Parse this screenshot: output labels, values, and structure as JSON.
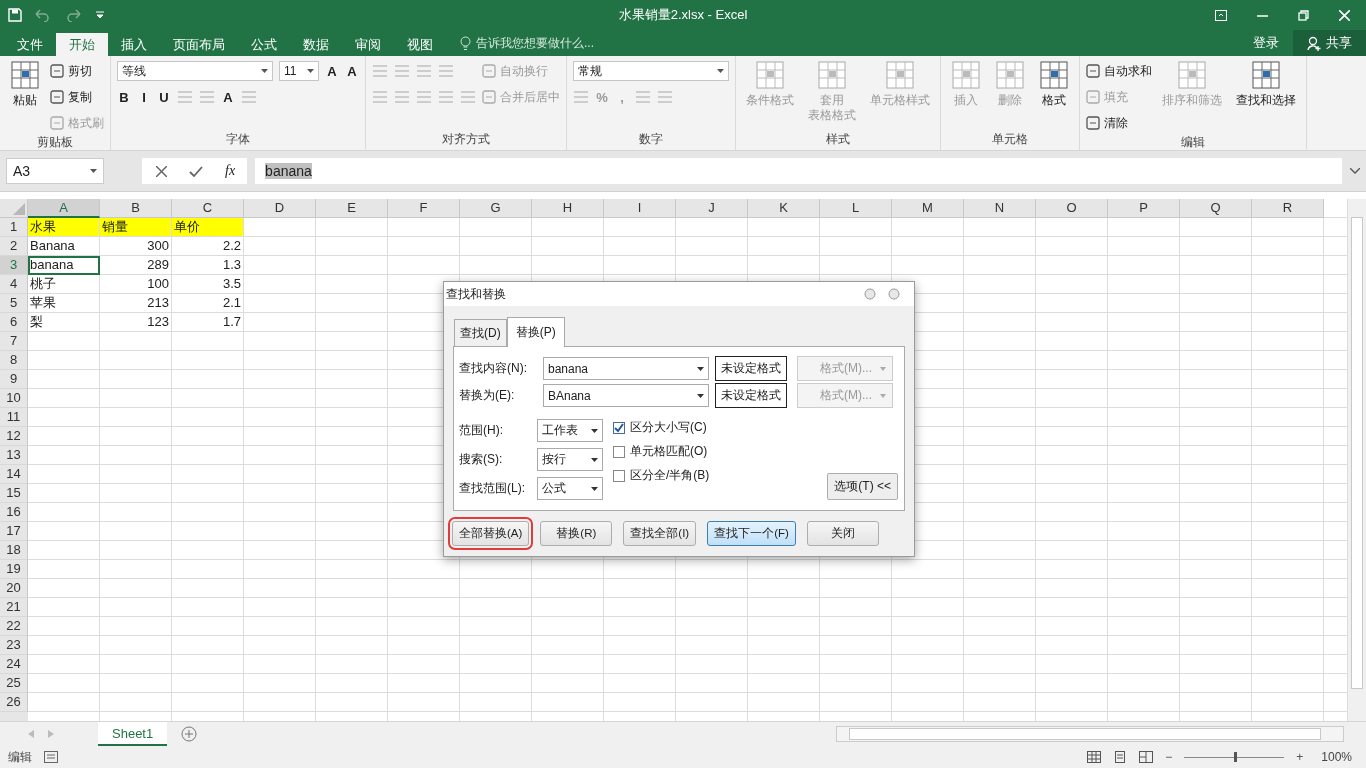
{
  "window": {
    "title": "水果销量2.xlsx - Excel"
  },
  "ribbon_tabs": [
    {
      "label": "文件",
      "selected": false
    },
    {
      "label": "开始",
      "selected": true
    },
    {
      "label": "插入",
      "selected": false
    },
    {
      "label": "页面布局",
      "selected": false
    },
    {
      "label": "公式",
      "selected": false
    },
    {
      "label": "数据",
      "selected": false
    },
    {
      "label": "审阅",
      "selected": false
    },
    {
      "label": "视图",
      "selected": false
    }
  ],
  "tell_me": "告诉我您想要做什么...",
  "account": {
    "login": "登录",
    "share": "共享"
  },
  "ribbon_groups": [
    {
      "label": "剪贴板",
      "columns": [
        {
          "kind": "large",
          "lines": [
            "粘贴"
          ],
          "disabled": false
        },
        {
          "kind": "stack",
          "lines": [
            {
              "parts": [
                {
                  "kind": "button",
                  "label": "剪切",
                  "disabled": false
                }
              ]
            },
            {
              "parts": [
                {
                  "kind": "button",
                  "label": "复制",
                  "disabled": false
                }
              ]
            },
            {
              "parts": [
                {
                  "kind": "button",
                  "label": "格式刷",
                  "disabled": true
                }
              ]
            }
          ]
        }
      ]
    },
    {
      "label": "字体",
      "columns": [
        {
          "kind": "stack",
          "lines": [
            {
              "parts": [
                {
                  "kind": "field",
                  "value": "等线"
                },
                {
                  "kind": "field",
                  "value": "11"
                },
                {
                  "kind": "glyph",
                  "label": "A",
                  "disabled": false
                },
                {
                  "kind": "glyph",
                  "label": "A",
                  "disabled": false
                }
              ]
            },
            {
              "parts": [
                {
                  "kind": "glyph",
                  "label": "B",
                  "disabled": false
                },
                {
                  "kind": "glyph",
                  "label": "I",
                  "disabled": false
                },
                {
                  "kind": "glyph",
                  "label": "U",
                  "disabled": false
                },
                {
                  "kind": "icon"
                },
                {
                  "kind": "icon"
                },
                {
                  "kind": "glyph",
                  "label": "A",
                  "disabled": false
                },
                {
                  "kind": "icon"
                }
              ]
            }
          ]
        }
      ]
    },
    {
      "label": "对齐方式",
      "columns": [
        {
          "kind": "stack",
          "lines": [
            {
              "parts": [
                {
                  "kind": "icon"
                },
                {
                  "kind": "icon"
                },
                {
                  "kind": "icon"
                },
                {
                  "kind": "icon"
                }
              ]
            },
            {
              "parts": [
                {
                  "kind": "icon"
                },
                {
                  "kind": "icon"
                },
                {
                  "kind": "icon"
                },
                {
                  "kind": "icon"
                },
                {
                  "kind": "icon"
                }
              ]
            }
          ]
        },
        {
          "kind": "stack",
          "lines": [
            {
              "parts": [
                {
                  "kind": "button",
                  "label": "自动换行",
                  "disabled": true
                }
              ]
            },
            {
              "parts": [
                {
                  "kind": "button",
                  "label": "合并后居中",
                  "disabled": true
                }
              ]
            }
          ]
        }
      ]
    },
    {
      "label": "数字",
      "columns": [
        {
          "kind": "stack",
          "lines": [
            {
              "parts": [
                {
                  "kind": "field",
                  "value": "常规"
                }
              ]
            },
            {
              "parts": [
                {
                  "kind": "icon"
                },
                {
                  "kind": "glyph",
                  "label": "%",
                  "disabled": true
                },
                {
                  "kind": "glyph",
                  "label": ",",
                  "disabled": true
                },
                {
                  "kind": "icon"
                },
                {
                  "kind": "icon"
                }
              ]
            }
          ]
        }
      ]
    },
    {
      "label": "样式",
      "columns": [
        {
          "kind": "large",
          "lines": [
            "条件格式"
          ],
          "disabled": true
        },
        {
          "kind": "large",
          "lines": [
            "套用",
            "表格格式"
          ],
          "disabled": true
        },
        {
          "kind": "large",
          "lines": [
            "单元格样式"
          ],
          "disabled": true
        }
      ]
    },
    {
      "label": "单元格",
      "columns": [
        {
          "kind": "large",
          "lines": [
            "插入"
          ],
          "disabled": true
        },
        {
          "kind": "large",
          "lines": [
            "删除"
          ],
          "disabled": true
        },
        {
          "kind": "large",
          "lines": [
            "格式"
          ],
          "disabled": false
        }
      ]
    },
    {
      "label": "编辑",
      "columns": [
        {
          "kind": "stack",
          "lines": [
            {
              "parts": [
                {
                  "kind": "button",
                  "label": "自动求和",
                  "disabled": false
                }
              ]
            },
            {
              "parts": [
                {
                  "kind": "button",
                  "label": "填充",
                  "disabled": true
                }
              ]
            },
            {
              "parts": [
                {
                  "kind": "button",
                  "label": "清除",
                  "disabled": false
                }
              ]
            }
          ]
        },
        {
          "kind": "large",
          "lines": [
            "排序和筛选"
          ],
          "disabled": true
        },
        {
          "kind": "large",
          "lines": [
            "查找和选择"
          ],
          "disabled": false
        }
      ]
    }
  ],
  "formula_bar": {
    "name_box": "A3",
    "function_label": "fx",
    "formula": "banana"
  },
  "columns": [
    {
      "label": "A",
      "selected": true
    },
    {
      "label": "B",
      "selected": false
    },
    {
      "label": "C",
      "selected": false
    },
    {
      "label": "D",
      "selected": false
    },
    {
      "label": "E",
      "selected": false
    },
    {
      "label": "F",
      "selected": false
    },
    {
      "label": "G",
      "selected": false
    },
    {
      "label": "H",
      "selected": false
    },
    {
      "label": "I",
      "selected": false
    },
    {
      "label": "J",
      "selected": false
    },
    {
      "label": "K",
      "selected": false
    },
    {
      "label": "L",
      "selected": false
    },
    {
      "label": "M",
      "selected": false
    },
    {
      "label": "N",
      "selected": false
    },
    {
      "label": "O",
      "selected": false
    },
    {
      "label": "P",
      "selected": false
    },
    {
      "label": "Q",
      "selected": false
    },
    {
      "label": "R",
      "selected": false
    }
  ],
  "rows": [
    {
      "label": "1",
      "selected": false,
      "cells": [
        {
          "text": "水果",
          "kind": "text",
          "highlighted": true,
          "selected": false
        },
        {
          "text": "销量",
          "kind": "text",
          "highlighted": true,
          "selected": false
        },
        {
          "text": "单价",
          "kind": "text",
          "highlighted": true,
          "selected": false
        }
      ]
    },
    {
      "label": "2",
      "selected": false,
      "cells": [
        {
          "text": "Banana",
          "kind": "text",
          "highlighted": false,
          "selected": false
        },
        {
          "text": "300",
          "kind": "number",
          "highlighted": false,
          "selected": false
        },
        {
          "text": "2.2",
          "kind": "number",
          "highlighted": false,
          "selected": false
        }
      ]
    },
    {
      "label": "3",
      "selected": true,
      "cells": [
        {
          "text": "banana",
          "kind": "text",
          "highlighted": false,
          "selected": true
        },
        {
          "text": "289",
          "kind": "number",
          "highlighted": false,
          "selected": false
        },
        {
          "text": "1.3",
          "kind": "number",
          "highlighted": false,
          "selected": false
        }
      ]
    },
    {
      "label": "4",
      "selected": false,
      "cells": [
        {
          "text": "桃子",
          "kind": "text",
          "highlighted": false,
          "selected": false
        },
        {
          "text": "100",
          "kind": "number",
          "highlighted": false,
          "selected": false
        },
        {
          "text": "3.5",
          "kind": "number",
          "highlighted": false,
          "selected": false
        }
      ]
    },
    {
      "label": "5",
      "selected": false,
      "cells": [
        {
          "text": "苹果",
          "kind": "text",
          "highlighted": false,
          "selected": false
        },
        {
          "text": "213",
          "kind": "number",
          "highlighted": false,
          "selected": false
        },
        {
          "text": "2.1",
          "kind": "number",
          "highlighted": false,
          "selected": false
        }
      ]
    },
    {
      "label": "6",
      "selected": false,
      "cells": [
        {
          "text": "梨",
          "kind": "text",
          "highlighted": false,
          "selected": false
        },
        {
          "text": "123",
          "kind": "number",
          "highlighted": false,
          "selected": false
        },
        {
          "text": "1.7",
          "kind": "number",
          "highlighted": false,
          "selected": false
        }
      ]
    },
    {
      "label": "7",
      "selected": false
    },
    {
      "label": "8",
      "selected": false
    },
    {
      "label": "9",
      "selected": false
    },
    {
      "label": "10",
      "selected": false
    },
    {
      "label": "11",
      "selected": false
    },
    {
      "label": "12",
      "selected": false
    },
    {
      "label": "13",
      "selected": false
    },
    {
      "label": "14",
      "selected": false
    },
    {
      "label": "15",
      "selected": false
    },
    {
      "label": "16",
      "selected": false
    },
    {
      "label": "17",
      "selected": false
    },
    {
      "label": "18",
      "selected": false
    },
    {
      "label": "19",
      "selected": false
    },
    {
      "label": "20",
      "selected": false
    },
    {
      "label": "21",
      "selected": false
    },
    {
      "label": "22",
      "selected": false
    },
    {
      "label": "23",
      "selected": false
    },
    {
      "label": "24",
      "selected": false
    },
    {
      "label": "25",
      "selected": false
    },
    {
      "label": "26",
      "selected": false
    }
  ],
  "sheet_tabs": [
    {
      "label": "Sheet1",
      "selected": true
    }
  ],
  "status_bar": {
    "mode": "编辑",
    "zoom_out": "−",
    "zoom_in": "+",
    "zoom": "100%",
    "zoom_slider": {
      "level": 0.5
    }
  },
  "dialog": {
    "title": "查找和替换",
    "tabs": [
      {
        "label": "查找(D)",
        "selected": false
      },
      {
        "label": "替换(P)",
        "selected": true
      }
    ],
    "fields": [
      {
        "label": "查找内容(N):",
        "value": "banana",
        "format": "未设定格式",
        "format_button": "格式(M)..."
      },
      {
        "label": "替换为(E):",
        "value": "BAnana",
        "format": "未设定格式",
        "format_button": "格式(M)..."
      }
    ],
    "selects": [
      {
        "label": "范围(H):",
        "value": "工作表"
      },
      {
        "label": "搜索(S):",
        "value": "按行"
      },
      {
        "label": "查找范围(L):",
        "value": "公式"
      }
    ],
    "checkboxes": [
      {
        "label": "区分大小写(C)",
        "checked": true
      },
      {
        "label": "单元格匹配(O)",
        "checked": false
      },
      {
        "label": "区分全/半角(B)",
        "checked": false
      }
    ],
    "options_button": "选项(T) <<",
    "buttons": [
      {
        "label": "全部替换(A)",
        "default": false,
        "annotated": true
      },
      {
        "label": "替换(R)",
        "default": false,
        "annotated": false
      },
      {
        "label": "查找全部(I)",
        "default": false,
        "annotated": false
      },
      {
        "label": "查找下一个(F)",
        "default": true,
        "annotated": false
      },
      {
        "label": "关闭",
        "default": false,
        "annotated": false
      }
    ]
  }
}
